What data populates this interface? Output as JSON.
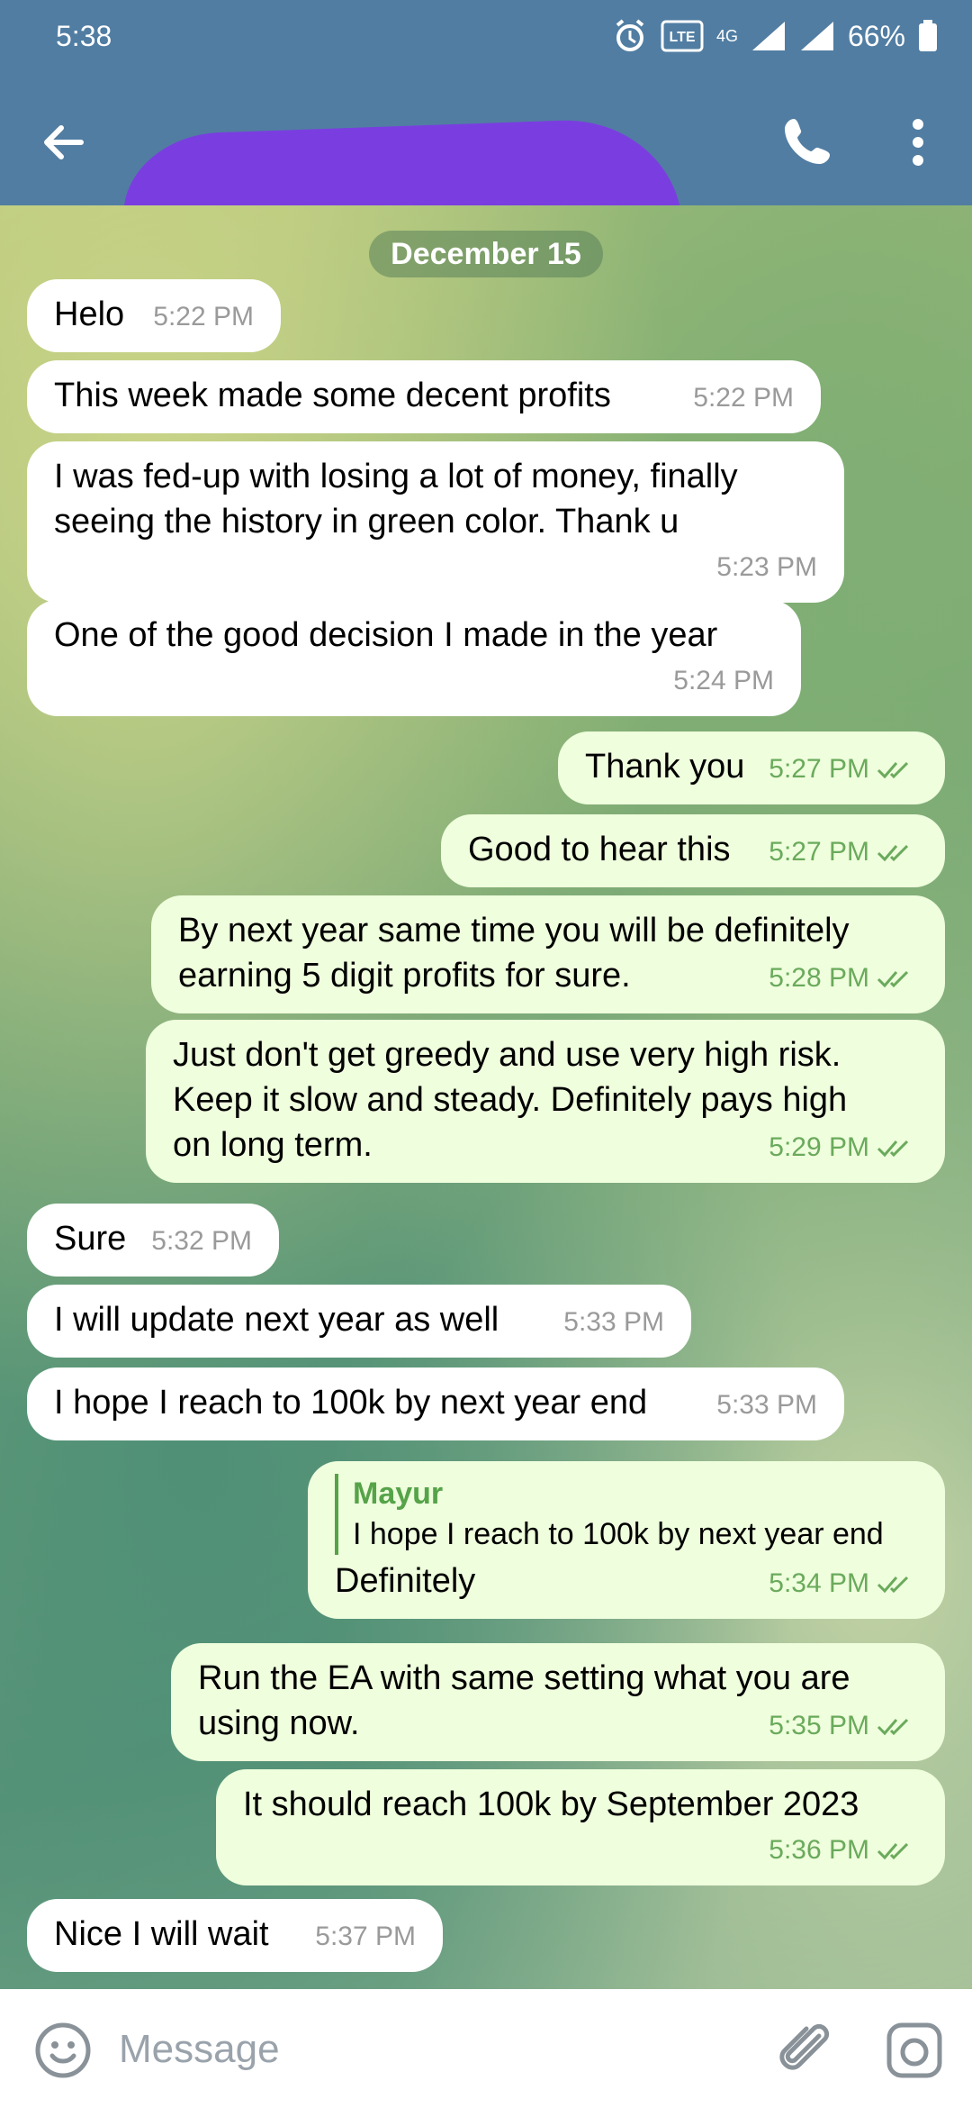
{
  "status_bar": {
    "time": "5:38",
    "network": "4G",
    "battery": "66%"
  },
  "header": {
    "contact_name_hidden": ""
  },
  "date_separator": "December 15",
  "messages": [
    {
      "dir": "in",
      "text": "Helo",
      "time": "5:22 PM"
    },
    {
      "dir": "in",
      "text": "This week made some decent profits",
      "time": "5:22 PM"
    },
    {
      "dir": "in",
      "text1": "I was fed-up with losing a lot of money, finally",
      "text2": "seeing the history in green color. Thank u",
      "time": "5:23 PM"
    },
    {
      "dir": "in",
      "text": "One of the good decision I made in the year",
      "time": "5:24 PM"
    },
    {
      "dir": "out",
      "text": "Thank you",
      "time": "5:27 PM"
    },
    {
      "dir": "out",
      "text": "Good to hear this",
      "time": "5:27 PM"
    },
    {
      "dir": "out",
      "text1": "By next year same time you will be definitely",
      "text2": "earning 5 digit profits for sure.",
      "time": "5:28 PM"
    },
    {
      "dir": "out",
      "text1": "Just don't get greedy and use very high risk.",
      "text2": "Keep it slow and steady. Definitely pays high",
      "text3": "on long term.",
      "time": "5:29 PM"
    },
    {
      "dir": "in",
      "text": "Sure",
      "time": "5:32 PM"
    },
    {
      "dir": "in",
      "text": "I will update next year as well",
      "time": "5:33 PM"
    },
    {
      "dir": "in",
      "text": "I hope I reach to 100k by next year end",
      "time": "5:33 PM"
    },
    {
      "dir": "out",
      "reply_name": "Mayur",
      "reply_text": "I hope I reach to 100k by next year end",
      "text": "Definitely",
      "time": "5:34 PM"
    },
    {
      "dir": "out",
      "text1": "Run the EA with same setting what you are",
      "text2": "using now.",
      "time": "5:35 PM"
    },
    {
      "dir": "out",
      "text": "It should reach 100k by September 2023",
      "time": "5:36 PM"
    },
    {
      "dir": "in",
      "text": "Nice I will wait",
      "time": "5:37 PM"
    }
  ],
  "composer": {
    "placeholder": "Message"
  },
  "colors": {
    "header": "#517DA2",
    "incoming": "#ffffff",
    "outgoing": "#effedd",
    "accent_green": "#56a349"
  }
}
